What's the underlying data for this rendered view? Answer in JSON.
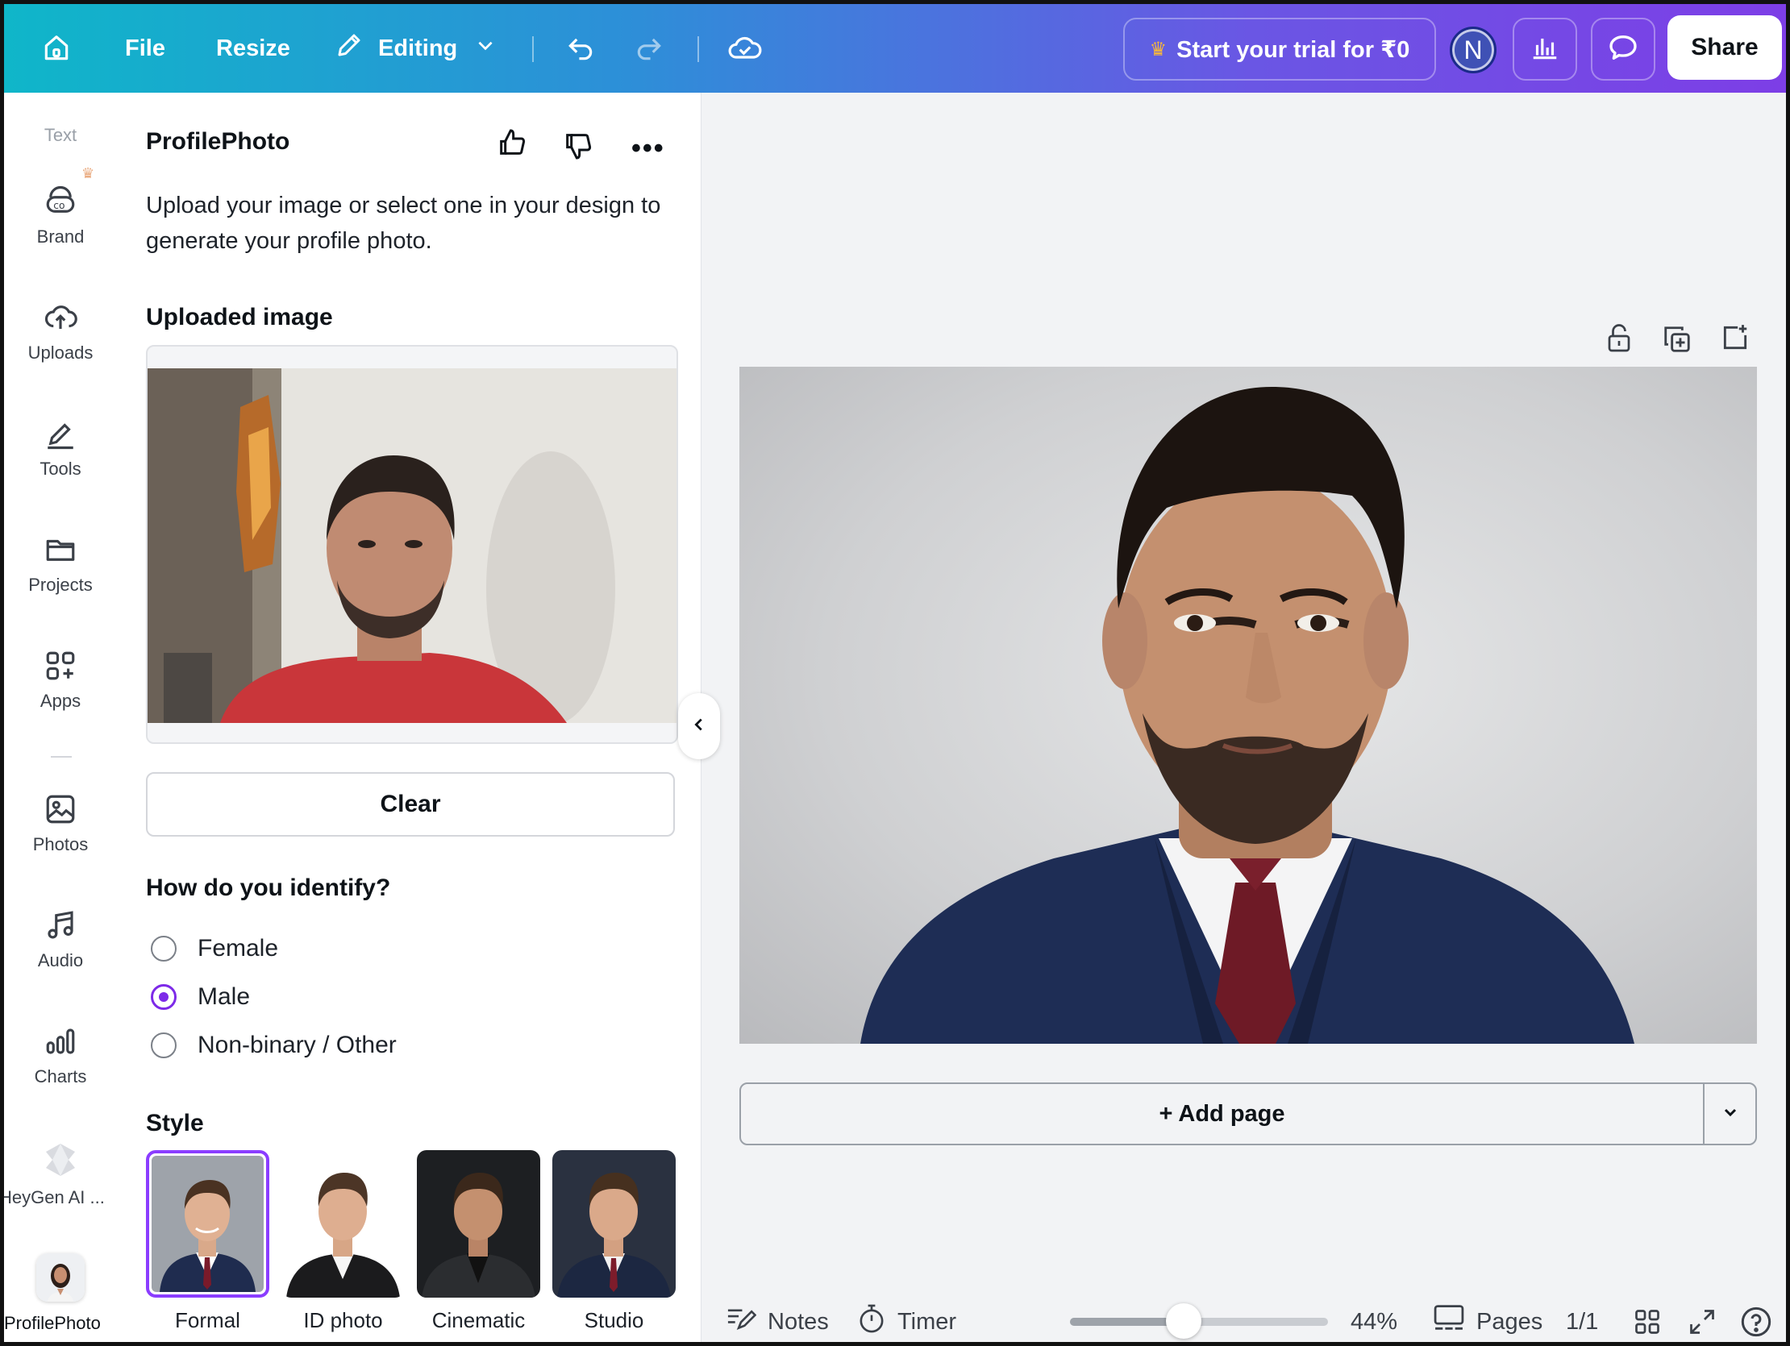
{
  "topbar": {
    "file": "File",
    "resize": "Resize",
    "editing": "Editing",
    "trial": "Start your trial for ₹0",
    "avatar_initial": "N",
    "share": "Share"
  },
  "rail": {
    "items": [
      {
        "label": "Text",
        "icon": "text-icon"
      },
      {
        "label": "Brand",
        "icon": "brand-icon"
      },
      {
        "label": "Uploads",
        "icon": "cloud-upload-icon"
      },
      {
        "label": "Tools",
        "icon": "pen-tool-icon"
      },
      {
        "label": "Projects",
        "icon": "folder-icon"
      },
      {
        "label": "Apps",
        "icon": "apps-grid-icon"
      },
      {
        "label": "Photos",
        "icon": "image-icon"
      },
      {
        "label": "Audio",
        "icon": "music-note-icon"
      },
      {
        "label": "Charts",
        "icon": "bar-chart-icon"
      },
      {
        "label": "HeyGen AI ...",
        "icon": "heygen-icon"
      },
      {
        "label": "ProfilePhoto",
        "icon": "profilephoto-app-icon"
      }
    ]
  },
  "panel": {
    "title": "ProfilePhoto",
    "description": "Upload your image or select one in your design to generate your profile photo.",
    "uploaded_heading": "Uploaded image",
    "clear": "Clear",
    "identify_heading": "How do you identify?",
    "identify_options": [
      {
        "label": "Female",
        "selected": false
      },
      {
        "label": "Male",
        "selected": true
      },
      {
        "label": "Non-binary / Other",
        "selected": false
      }
    ],
    "style_heading": "Style",
    "styles": [
      {
        "label": "Formal",
        "selected": true
      },
      {
        "label": "ID photo",
        "selected": false
      },
      {
        "label": "Cinematic",
        "selected": false
      },
      {
        "label": "Studio",
        "selected": false
      }
    ]
  },
  "canvas": {
    "add_page": "+ Add page"
  },
  "bottombar": {
    "notes": "Notes",
    "timer": "Timer",
    "zoom": "44%",
    "zoom_level": 0.44,
    "pages": "Pages",
    "page_count": "1/1"
  },
  "colors": {
    "accent": "#7d2ae8",
    "topbar_start": "#0fb6c9",
    "topbar_end": "#7d3ee6"
  }
}
